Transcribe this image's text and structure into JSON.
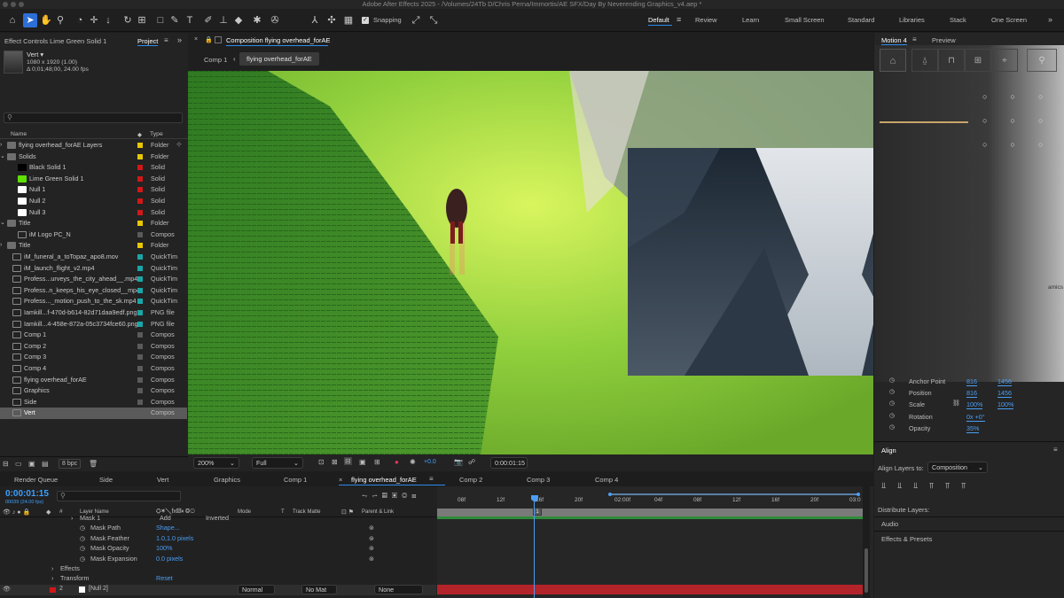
{
  "title": "Adobe After Effects 2025 - /Volumes/24Tb D/Chris Perna/Immortis/AE SFX/Day By Neverending Graphics_v4.aep *",
  "toolbar": {
    "snapping_label": "Snapping",
    "workspaces": [
      "Default",
      "Review",
      "Learn",
      "Small Screen",
      "Standard",
      "Libraries",
      "Stack",
      "One Screen"
    ]
  },
  "project_panel": {
    "effect_controls_tab": "Effect Controls Lime Green Solid 1",
    "project_tab": "Project",
    "selected_name": "Vert ▾",
    "selected_res": "1080 x 1920 (1.00)",
    "selected_dur": "Δ 0;01;48;00, 24.00 fps",
    "search_placeholder": "",
    "col_name": "Name",
    "col_type": "Type",
    "bpc": "8 bpc",
    "items": [
      {
        "name": "flying overhead_forAE Layers",
        "type": "Folder",
        "color": "#e8c800",
        "indent": 0,
        "kind": "folder"
      },
      {
        "name": "Solids",
        "type": "Folder",
        "color": "#e8c800",
        "indent": 0,
        "kind": "folder"
      },
      {
        "name": "Black Solid 1",
        "type": "Solid",
        "color": "#d01818",
        "indent": 2,
        "kind": "solid",
        "thumb": "#000000"
      },
      {
        "name": "Lime Green Solid 1",
        "type": "Solid",
        "color": "#d01818",
        "indent": 2,
        "kind": "solid",
        "thumb": "#5ee000"
      },
      {
        "name": "Null 1",
        "type": "Solid",
        "color": "#d01818",
        "indent": 2,
        "kind": "solid",
        "thumb": "#ffffff"
      },
      {
        "name": "Null 2",
        "type": "Solid",
        "color": "#d01818",
        "indent": 2,
        "kind": "solid",
        "thumb": "#ffffff"
      },
      {
        "name": "Null 3",
        "type": "Solid",
        "color": "#d01818",
        "indent": 2,
        "kind": "solid",
        "thumb": "#ffffff"
      },
      {
        "name": "Title",
        "type": "Folder",
        "color": "#e8c800",
        "indent": 0,
        "kind": "folder"
      },
      {
        "name": "iM Logo PC_N",
        "type": "Compos",
        "color": "#5a5a5a",
        "indent": 2,
        "kind": "comp"
      },
      {
        "name": "Title",
        "type": "Folder",
        "color": "#e8c800",
        "indent": 0,
        "kind": "folder"
      },
      {
        "name": "iM_funeral_a_toTopaz_apo8.mov",
        "type": "QuickTim",
        "color": "#1aa6a6",
        "indent": 1,
        "kind": "file"
      },
      {
        "name": "iM_launch_flight_v2.mp4",
        "type": "QuickTim",
        "color": "#1aa6a6",
        "indent": 1,
        "kind": "file"
      },
      {
        "name": "Profess...urveys_the_city_ahead__.mp4",
        "type": "QuickTim",
        "color": "#1aa6a6",
        "indent": 1,
        "kind": "file"
      },
      {
        "name": "Profess..n_keeps_his_eye_closed__mp4",
        "type": "QuickTim",
        "color": "#1aa6a6",
        "indent": 1,
        "kind": "file"
      },
      {
        "name": "Profess..._motion_push_to_the_sk.mp4",
        "type": "QuickTim",
        "color": "#1aa6a6",
        "indent": 1,
        "kind": "file"
      },
      {
        "name": "Iamkill...f-470d-b614-82d71daa9edf.png",
        "type": "PNG file",
        "color": "#1aa6a6",
        "indent": 1,
        "kind": "file"
      },
      {
        "name": "Iamkill...4-458e-872a-05c3734fce60.png",
        "type": "PNG file",
        "color": "#1aa6a6",
        "indent": 1,
        "kind": "file"
      },
      {
        "name": "Comp 1",
        "type": "Compos",
        "color": "#5a5a5a",
        "indent": 1,
        "kind": "comp"
      },
      {
        "name": "Comp 2",
        "type": "Compos",
        "color": "#5a5a5a",
        "indent": 1,
        "kind": "comp"
      },
      {
        "name": "Comp 3",
        "type": "Compos",
        "color": "#5a5a5a",
        "indent": 1,
        "kind": "comp"
      },
      {
        "name": "Comp 4",
        "type": "Compos",
        "color": "#5a5a5a",
        "indent": 1,
        "kind": "comp"
      },
      {
        "name": "flying overhead_forAE",
        "type": "Compos",
        "color": "#5a5a5a",
        "indent": 1,
        "kind": "comp"
      },
      {
        "name": "Graphics",
        "type": "Compos",
        "color": "#5a5a5a",
        "indent": 1,
        "kind": "comp"
      },
      {
        "name": "Side",
        "type": "Compos",
        "color": "#5a5a5a",
        "indent": 1,
        "kind": "comp"
      },
      {
        "name": "Vert",
        "type": "Compos",
        "color": "#5a5a5a",
        "indent": 1,
        "kind": "comp",
        "selected": true
      }
    ]
  },
  "composition": {
    "tab_label": "Composition flying overhead_forAE",
    "crumbs": [
      "Comp 1",
      "flying overhead_forAE"
    ],
    "zoom": "200%",
    "quality": "Full",
    "exposure": "+0.0",
    "timecode": "0:00:01:15"
  },
  "right_panel": {
    "tabs": [
      "Motion 4",
      "Preview"
    ],
    "right_edge_text": "amics",
    "properties": [
      {
        "label": "Anchor Point",
        "v1": "816",
        "v2": "1456"
      },
      {
        "label": "Position",
        "v1": "816",
        "v2": "1456"
      },
      {
        "label": "Scale",
        "v1": "100%",
        "v2": "100%"
      },
      {
        "label": "Rotation",
        "v1": "0x +0°",
        "v2": ""
      },
      {
        "label": "Opacity",
        "v1": "35%",
        "v2": ""
      }
    ],
    "align_title": "Align",
    "align_to_label": "Align Layers to:",
    "align_to_value": "Composition",
    "distribute_label": "Distribute Layers:",
    "audio_label": "Audio",
    "effects_label": "Effects & Presets"
  },
  "timeline": {
    "tabs": [
      "Render Queue",
      "Side",
      "Vert",
      "Graphics",
      "Comp 1",
      "flying overhead_forAE",
      "Comp 2",
      "Comp 3",
      "Comp 4"
    ],
    "active_tab": "flying overhead_forAE",
    "timecode": "0:00:01:15",
    "frame": "00039 (24.00 fps)",
    "headers": {
      "layer_name": "Layer Name",
      "mode": "Mode",
      "t": "T",
      "track_matte": "Track Matte",
      "parent": "Parent & Link"
    },
    "ruler": [
      "08f",
      "12f",
      "16f",
      "20f",
      "02:00f",
      "04f",
      "08f",
      "12f",
      "16f",
      "20f",
      "03:0"
    ],
    "playhead_marker": "1",
    "rows": [
      {
        "label": "Mask 1",
        "value": "Add",
        "extra": "Inverted",
        "indent": 90
      },
      {
        "label": "Mask Path",
        "value": "Shape...",
        "indent": 102,
        "stopwatch": true
      },
      {
        "label": "Mask Feather",
        "value": "1.0,1.0 pixels",
        "indent": 102,
        "stopwatch": true
      },
      {
        "label": "Mask Opacity",
        "value": "100%",
        "indent": 102,
        "stopwatch": true
      },
      {
        "label": "Mask Expansion",
        "value": "0.0 pixels",
        "indent": 102,
        "stopwatch": true
      },
      {
        "label": "Effects",
        "value": "",
        "indent": 68
      },
      {
        "label": "Transform",
        "value": "Reset",
        "indent": 68
      }
    ],
    "layer": {
      "num": "2",
      "name": "[Null 2]",
      "mode": "Normal",
      "matte": "No Mat",
      "parent": "None"
    }
  }
}
